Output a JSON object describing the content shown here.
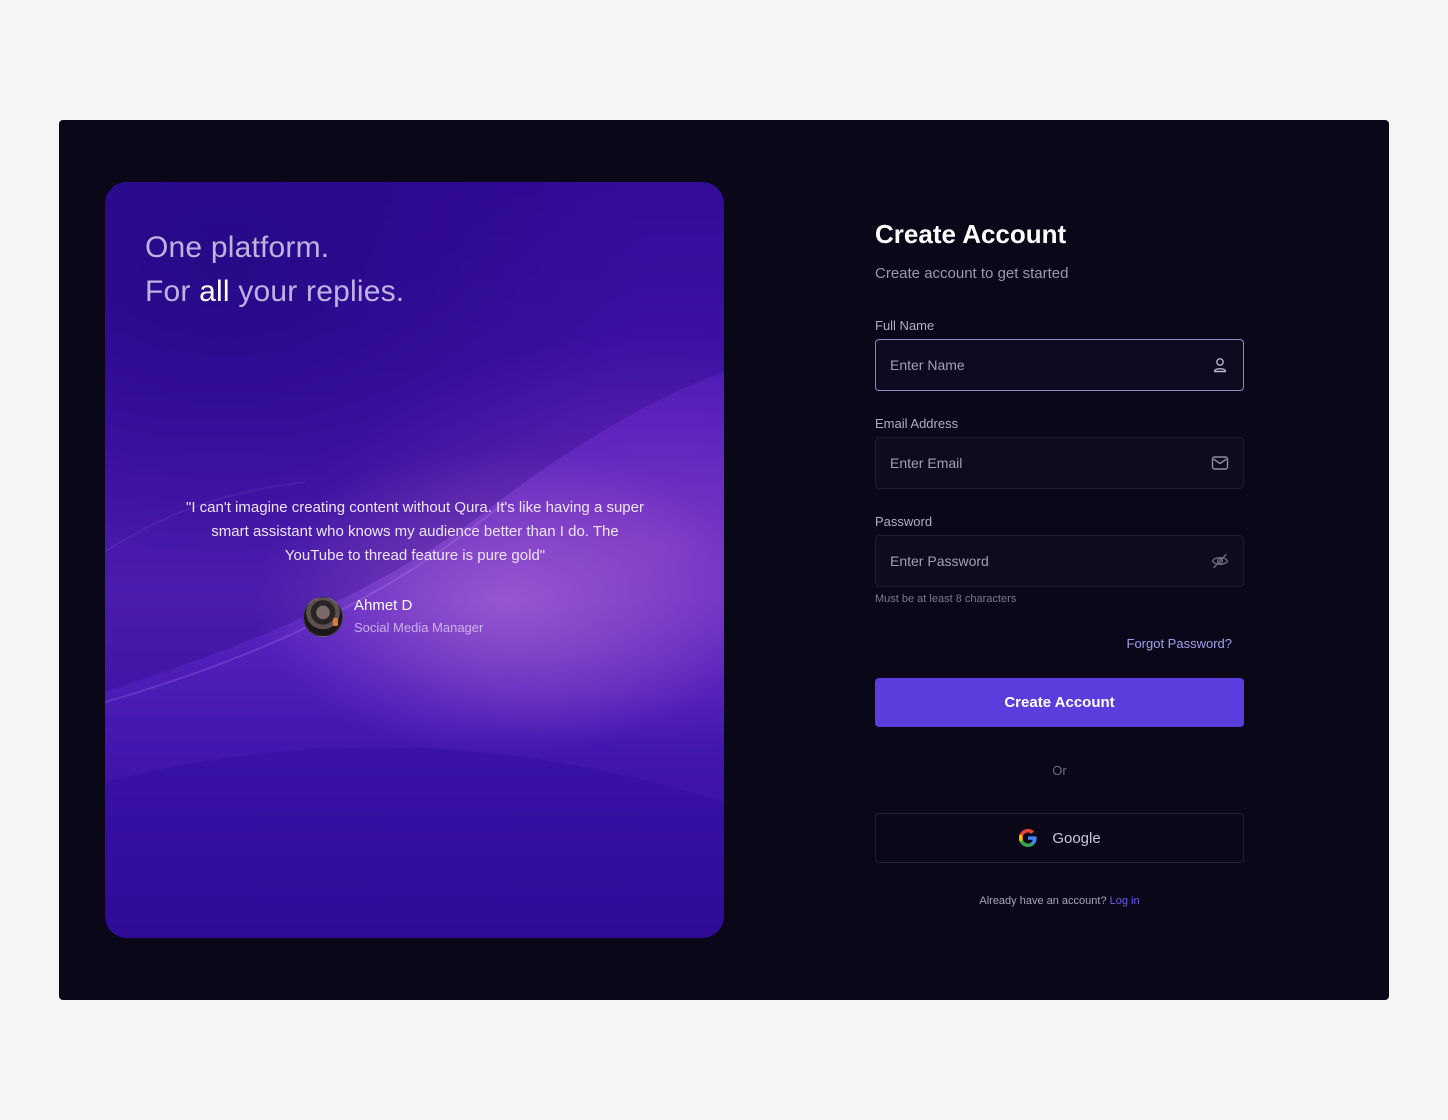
{
  "promo": {
    "headline_line1": "One platform.",
    "headline_line2_pre": "For",
    "headline_line2_strong": "all",
    "headline_line2_post": "your replies.",
    "quote": "\"I can't imagine creating content without Qura. It's like having a super smart assistant who knows my audience better than I do. The YouTube to thread feature is pure gold\"",
    "author_name": "Ahmet D",
    "author_role": "Social Media Manager"
  },
  "form": {
    "title": "Create Account",
    "subtitle": "Create account to get started",
    "full_name_label": "Full Name",
    "full_name_placeholder": "Enter Name",
    "full_name_value": "",
    "email_label": "Email Address",
    "email_placeholder": "Enter Email",
    "email_value": "",
    "password_label": "Password",
    "password_placeholder": "Enter Password",
    "password_value": "",
    "password_hint": "Must be at least 8 characters",
    "forgot_label": "Forgot Password?",
    "submit_label": "Create Account",
    "divider_label": "Or",
    "google_label": "Google",
    "footer_text": "Already have an account?",
    "footer_link": "Log in"
  },
  "icons": {
    "name_field": "user-icon",
    "email_field": "mail-icon",
    "password_field": "eye-off-icon",
    "google": "google-logo-icon"
  },
  "colors": {
    "accent": "#5a3ddc",
    "link": "#6d57f0",
    "background": "#0a0718"
  }
}
